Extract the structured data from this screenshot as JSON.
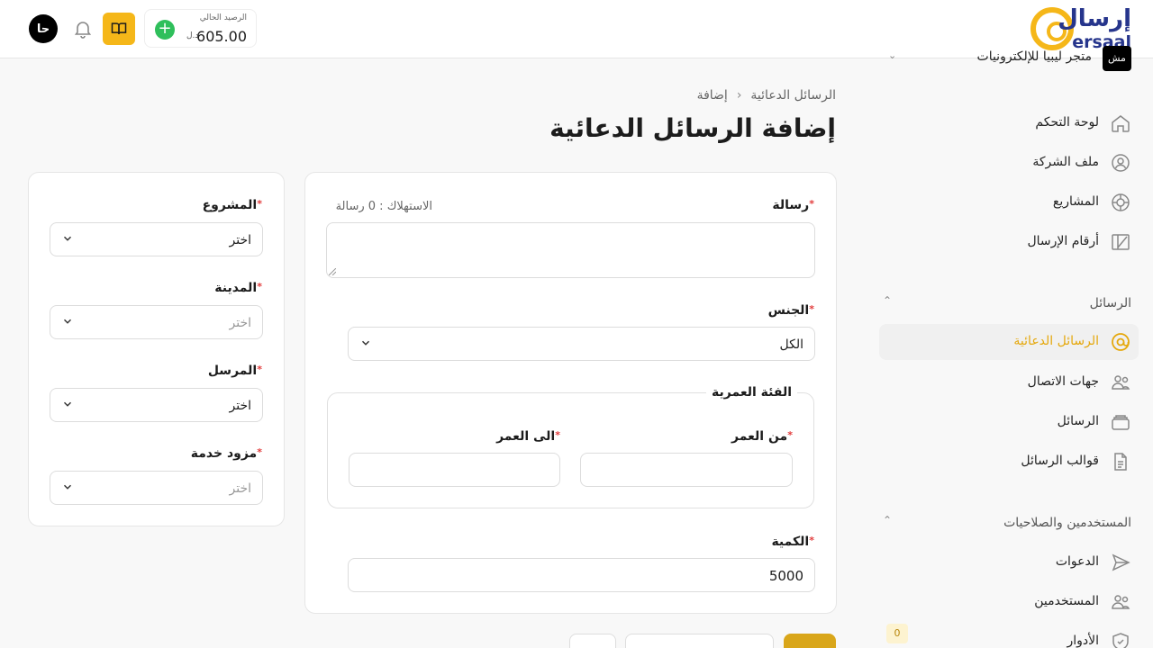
{
  "header": {
    "logo_ar": "إرسال",
    "logo_en": "ersaal",
    "avatar_initials": "حا",
    "balance_label": "الرصيد الحالي",
    "balance_value": "605.00",
    "balance_currency": "د.ل"
  },
  "sidebar": {
    "store_badge": "مش",
    "store_name": "متجر ليبيا للإلكترونيات",
    "items": [
      {
        "label": "لوحة التحكم",
        "icon": "home-icon"
      },
      {
        "label": "ملف الشركة",
        "icon": "user-circle-icon"
      },
      {
        "label": "المشاريع",
        "icon": "globe-icon"
      },
      {
        "label": "أرقام الإرسال",
        "icon": "sender-numbers-icon"
      }
    ],
    "section_messages": "الرسائل",
    "messages_items": [
      {
        "label": "الرسائل الدعائية",
        "icon": "at-icon",
        "active": true
      },
      {
        "label": "جهات الاتصال",
        "icon": "contacts-icon"
      },
      {
        "label": "الرسائل",
        "icon": "messages-stack-icon"
      },
      {
        "label": "قوالب الرسائل",
        "icon": "template-file-icon"
      }
    ],
    "section_users": "المستخدمين والصلاحيات",
    "users_items": [
      {
        "label": "الدعوات",
        "icon": "send-icon"
      },
      {
        "label": "المستخدمين",
        "icon": "users-icon"
      },
      {
        "label": "الأدوار",
        "icon": "shield-icon",
        "badge": "0"
      }
    ]
  },
  "breadcrumb": {
    "parent": "الرسائل الدعائية",
    "current": "إضافة"
  },
  "page_title": "إضافة الرسائل الدعائية",
  "form": {
    "message_label": "رسالة",
    "consumption_text": "الاستهلاك : 0 رسالة",
    "gender_label": "الجنس",
    "gender_value": "الكل",
    "age_group_legend": "الفئة العمرية",
    "age_from_label": "من العمر",
    "age_to_label": "الى العمر",
    "quantity_label": "الكمية",
    "quantity_value": "5000"
  },
  "side_form": {
    "project_label": "المشروع",
    "project_value": "اختر",
    "city_label": "المدينة",
    "city_placeholder": "اختر",
    "sender_label": "المرسل",
    "sender_value": "اختر",
    "provider_label": "مزود خدمة",
    "provider_placeholder": "اختر"
  },
  "colors": {
    "accent": "#f5b719",
    "brand_blue": "#26358c",
    "active_text": "#e5a80d",
    "required": "#e23b3b"
  }
}
